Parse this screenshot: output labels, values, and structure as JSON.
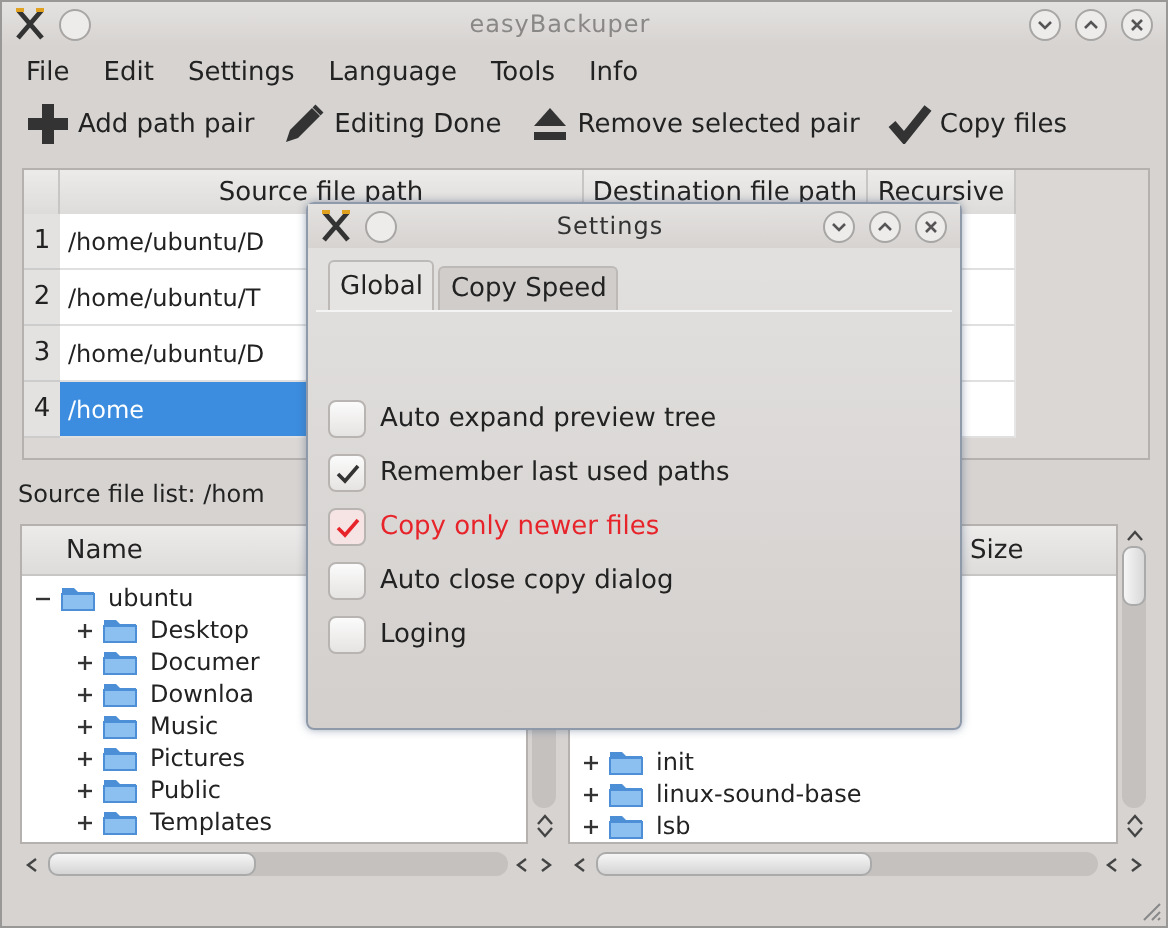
{
  "window": {
    "title": "easyBackuper"
  },
  "menu": [
    {
      "label": "File"
    },
    {
      "label": "Edit"
    },
    {
      "label": "Settings"
    },
    {
      "label": "Language"
    },
    {
      "label": "Tools"
    },
    {
      "label": "Info"
    }
  ],
  "toolbar": [
    {
      "label": "Add path pair",
      "kind": "plus"
    },
    {
      "label": "Editing Done",
      "kind": "pencil"
    },
    {
      "label": "Remove selected pair",
      "kind": "eject"
    },
    {
      "label": "Copy files",
      "kind": "check"
    }
  ],
  "table": {
    "columns": [
      "Source file path",
      "Destination file path",
      "Recursive"
    ],
    "rows": [
      {
        "number": "1",
        "source": "/home/ubuntu/D",
        "selected": false
      },
      {
        "number": "2",
        "source": "/home/ubuntu/T",
        "selected": false
      },
      {
        "number": "3",
        "source": "/home/ubuntu/D",
        "selected": false
      },
      {
        "number": "4",
        "source": "/home",
        "selected": true
      }
    ]
  },
  "source_label": "Source file list: /hom",
  "source_tree": {
    "columns": [
      "Name"
    ],
    "items": [
      {
        "label": "ubuntu",
        "expanded": true,
        "children": [
          {
            "label": "Desktop",
            "expanded": false
          },
          {
            "label": "Documer",
            "expanded": false
          },
          {
            "label": "Downloa",
            "expanded": false
          },
          {
            "label": "Music",
            "expanded": false
          },
          {
            "label": "Pictures",
            "expanded": false
          },
          {
            "label": "Public",
            "expanded": false
          },
          {
            "label": "Templates",
            "expanded": false
          }
        ]
      }
    ]
  },
  "destination_tree": {
    "columns": [
      "Size"
    ],
    "items": [
      {
        "label": "init",
        "expanded": false
      },
      {
        "label": "linux-sound-base",
        "expanded": false
      },
      {
        "label": "lsb",
        "expanded": false
      }
    ]
  },
  "dialog": {
    "title": "Settings",
    "tabs": [
      {
        "label": "Global",
        "selected": true
      },
      {
        "label": "Copy Speed",
        "selected": false
      }
    ],
    "options": [
      {
        "label": "Auto expand preview tree",
        "checked": false,
        "highlighted": false
      },
      {
        "label": "Remember last used paths",
        "checked": true,
        "highlighted": false
      },
      {
        "label": "Copy only newer files",
        "checked": true,
        "highlighted": true
      },
      {
        "label": "Auto close copy dialog",
        "checked": false,
        "highlighted": false
      },
      {
        "label": "Loging",
        "checked": false,
        "highlighted": false
      }
    ]
  }
}
